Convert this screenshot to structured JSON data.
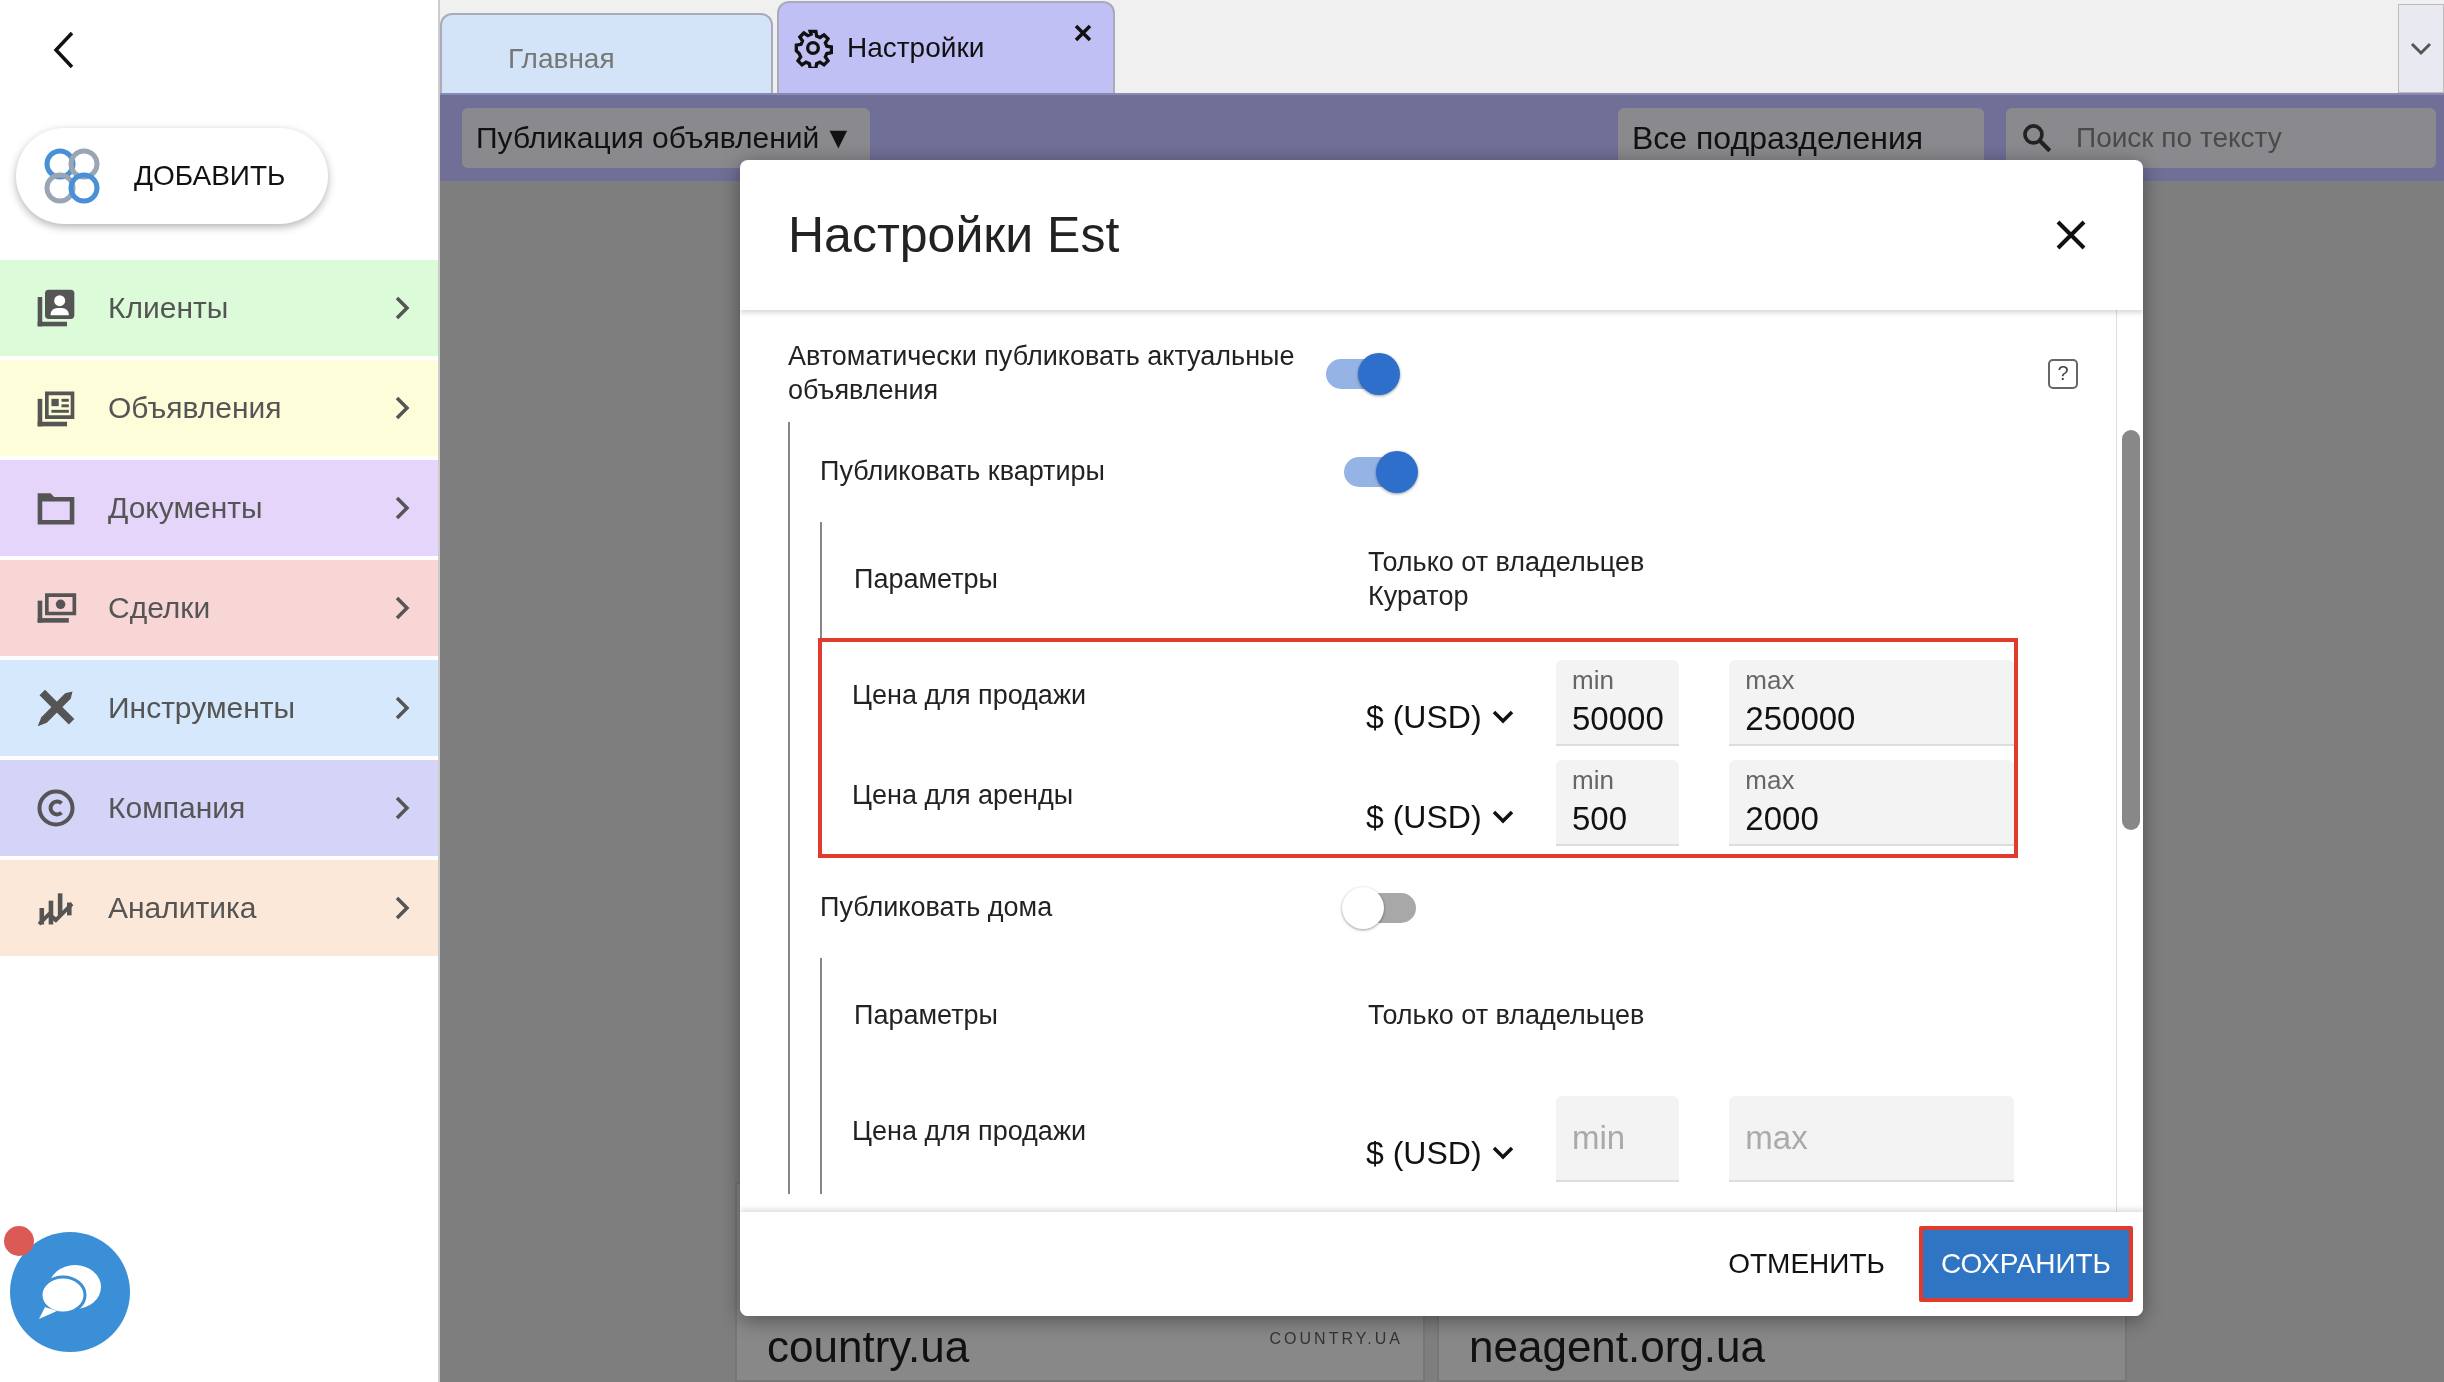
{
  "add_button": {
    "label": "ДОБАВИТЬ"
  },
  "sidebar": {
    "items": [
      {
        "label": "Клиенты",
        "color": "#dcfcd9"
      },
      {
        "label": "Объявления",
        "color": "#fdfdd9"
      },
      {
        "label": "Документы",
        "color": "#e5d5fb"
      },
      {
        "label": "Сделки",
        "color": "#f8d6d6"
      },
      {
        "label": "Инструменты",
        "color": "#d6e8fb"
      },
      {
        "label": "Компания",
        "color": "#d4d3f8"
      },
      {
        "label": "Аналитика",
        "color": "#fce8d8"
      }
    ]
  },
  "chat": {
    "has_notification": true
  },
  "tabs": [
    {
      "label": "Главная",
      "selected": false,
      "closable": false
    },
    {
      "label": "Настройки",
      "selected": true,
      "closable": true
    }
  ],
  "toolbar": {
    "category": "Публикация объявлений",
    "category_caret": "▼",
    "department": "Все подразделения",
    "search": {
      "placeholder": "Поиск по тексту"
    }
  },
  "background_cards": [
    {
      "title": "country.ua",
      "logo": "COUNTRY.UA"
    },
    {
      "title": "neagent.org.ua"
    }
  ],
  "modal": {
    "title": "Настройки Est",
    "auto_publish": {
      "label": "Автоматически публиковать актуальные объявления",
      "on": true,
      "help": "?"
    },
    "sections": [
      {
        "label": "Публиковать квартиры",
        "on": true,
        "params_label": "Параметры",
        "params_values": [
          "Только от владельцев",
          "Куратор"
        ],
        "highlighted": true,
        "prices": [
          {
            "label": "Цена для продажи",
            "currency": "$ (USD)",
            "min": {
              "placeholder": "min",
              "value": "50000"
            },
            "max": {
              "placeholder": "max",
              "value": "250000"
            }
          },
          {
            "label": "Цена для аренды",
            "currency": "$ (USD)",
            "min": {
              "placeholder": "min",
              "value": "500"
            },
            "max": {
              "placeholder": "max",
              "value": "2000"
            }
          }
        ]
      },
      {
        "label": "Публиковать дома",
        "on": false,
        "params_label": "Параметры",
        "params_values": [
          "Только от владельцев"
        ],
        "highlighted": false,
        "prices": [
          {
            "label": "Цена для продажи",
            "currency": "$ (USD)",
            "min": {
              "placeholder": "min"
            },
            "max": {
              "placeholder": "max"
            }
          }
        ]
      }
    ],
    "cancel": "ОТМЕНИТЬ",
    "save": {
      "label": "СОХРАНИТЬ",
      "highlighted": true
    }
  }
}
